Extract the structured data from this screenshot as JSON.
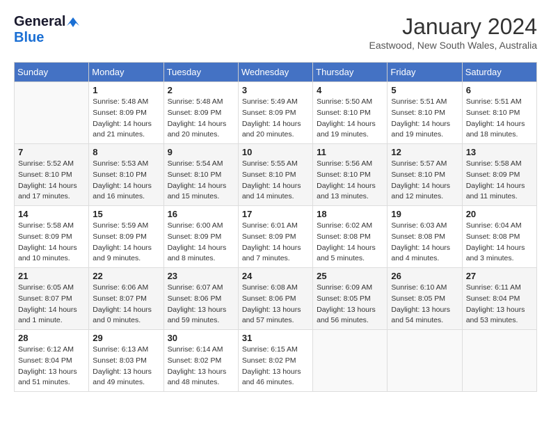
{
  "logo": {
    "general": "General",
    "blue": "Blue"
  },
  "title": "January 2024",
  "subtitle": "Eastwood, New South Wales, Australia",
  "days_header": [
    "Sunday",
    "Monday",
    "Tuesday",
    "Wednesday",
    "Thursday",
    "Friday",
    "Saturday"
  ],
  "weeks": [
    [
      {
        "day": "",
        "detail": ""
      },
      {
        "day": "1",
        "detail": "Sunrise: 5:48 AM\nSunset: 8:09 PM\nDaylight: 14 hours\nand 21 minutes."
      },
      {
        "day": "2",
        "detail": "Sunrise: 5:48 AM\nSunset: 8:09 PM\nDaylight: 14 hours\nand 20 minutes."
      },
      {
        "day": "3",
        "detail": "Sunrise: 5:49 AM\nSunset: 8:09 PM\nDaylight: 14 hours\nand 20 minutes."
      },
      {
        "day": "4",
        "detail": "Sunrise: 5:50 AM\nSunset: 8:10 PM\nDaylight: 14 hours\nand 19 minutes."
      },
      {
        "day": "5",
        "detail": "Sunrise: 5:51 AM\nSunset: 8:10 PM\nDaylight: 14 hours\nand 19 minutes."
      },
      {
        "day": "6",
        "detail": "Sunrise: 5:51 AM\nSunset: 8:10 PM\nDaylight: 14 hours\nand 18 minutes."
      }
    ],
    [
      {
        "day": "7",
        "detail": "Sunrise: 5:52 AM\nSunset: 8:10 PM\nDaylight: 14 hours\nand 17 minutes."
      },
      {
        "day": "8",
        "detail": "Sunrise: 5:53 AM\nSunset: 8:10 PM\nDaylight: 14 hours\nand 16 minutes."
      },
      {
        "day": "9",
        "detail": "Sunrise: 5:54 AM\nSunset: 8:10 PM\nDaylight: 14 hours\nand 15 minutes."
      },
      {
        "day": "10",
        "detail": "Sunrise: 5:55 AM\nSunset: 8:10 PM\nDaylight: 14 hours\nand 14 minutes."
      },
      {
        "day": "11",
        "detail": "Sunrise: 5:56 AM\nSunset: 8:10 PM\nDaylight: 14 hours\nand 13 minutes."
      },
      {
        "day": "12",
        "detail": "Sunrise: 5:57 AM\nSunset: 8:10 PM\nDaylight: 14 hours\nand 12 minutes."
      },
      {
        "day": "13",
        "detail": "Sunrise: 5:58 AM\nSunset: 8:09 PM\nDaylight: 14 hours\nand 11 minutes."
      }
    ],
    [
      {
        "day": "14",
        "detail": "Sunrise: 5:58 AM\nSunset: 8:09 PM\nDaylight: 14 hours\nand 10 minutes."
      },
      {
        "day": "15",
        "detail": "Sunrise: 5:59 AM\nSunset: 8:09 PM\nDaylight: 14 hours\nand 9 minutes."
      },
      {
        "day": "16",
        "detail": "Sunrise: 6:00 AM\nSunset: 8:09 PM\nDaylight: 14 hours\nand 8 minutes."
      },
      {
        "day": "17",
        "detail": "Sunrise: 6:01 AM\nSunset: 8:09 PM\nDaylight: 14 hours\nand 7 minutes."
      },
      {
        "day": "18",
        "detail": "Sunrise: 6:02 AM\nSunset: 8:08 PM\nDaylight: 14 hours\nand 5 minutes."
      },
      {
        "day": "19",
        "detail": "Sunrise: 6:03 AM\nSunset: 8:08 PM\nDaylight: 14 hours\nand 4 minutes."
      },
      {
        "day": "20",
        "detail": "Sunrise: 6:04 AM\nSunset: 8:08 PM\nDaylight: 14 hours\nand 3 minutes."
      }
    ],
    [
      {
        "day": "21",
        "detail": "Sunrise: 6:05 AM\nSunset: 8:07 PM\nDaylight: 14 hours\nand 1 minute."
      },
      {
        "day": "22",
        "detail": "Sunrise: 6:06 AM\nSunset: 8:07 PM\nDaylight: 14 hours\nand 0 minutes."
      },
      {
        "day": "23",
        "detail": "Sunrise: 6:07 AM\nSunset: 8:06 PM\nDaylight: 13 hours\nand 59 minutes."
      },
      {
        "day": "24",
        "detail": "Sunrise: 6:08 AM\nSunset: 8:06 PM\nDaylight: 13 hours\nand 57 minutes."
      },
      {
        "day": "25",
        "detail": "Sunrise: 6:09 AM\nSunset: 8:05 PM\nDaylight: 13 hours\nand 56 minutes."
      },
      {
        "day": "26",
        "detail": "Sunrise: 6:10 AM\nSunset: 8:05 PM\nDaylight: 13 hours\nand 54 minutes."
      },
      {
        "day": "27",
        "detail": "Sunrise: 6:11 AM\nSunset: 8:04 PM\nDaylight: 13 hours\nand 53 minutes."
      }
    ],
    [
      {
        "day": "28",
        "detail": "Sunrise: 6:12 AM\nSunset: 8:04 PM\nDaylight: 13 hours\nand 51 minutes."
      },
      {
        "day": "29",
        "detail": "Sunrise: 6:13 AM\nSunset: 8:03 PM\nDaylight: 13 hours\nand 49 minutes."
      },
      {
        "day": "30",
        "detail": "Sunrise: 6:14 AM\nSunset: 8:02 PM\nDaylight: 13 hours\nand 48 minutes."
      },
      {
        "day": "31",
        "detail": "Sunrise: 6:15 AM\nSunset: 8:02 PM\nDaylight: 13 hours\nand 46 minutes."
      },
      {
        "day": "",
        "detail": ""
      },
      {
        "day": "",
        "detail": ""
      },
      {
        "day": "",
        "detail": ""
      }
    ]
  ]
}
